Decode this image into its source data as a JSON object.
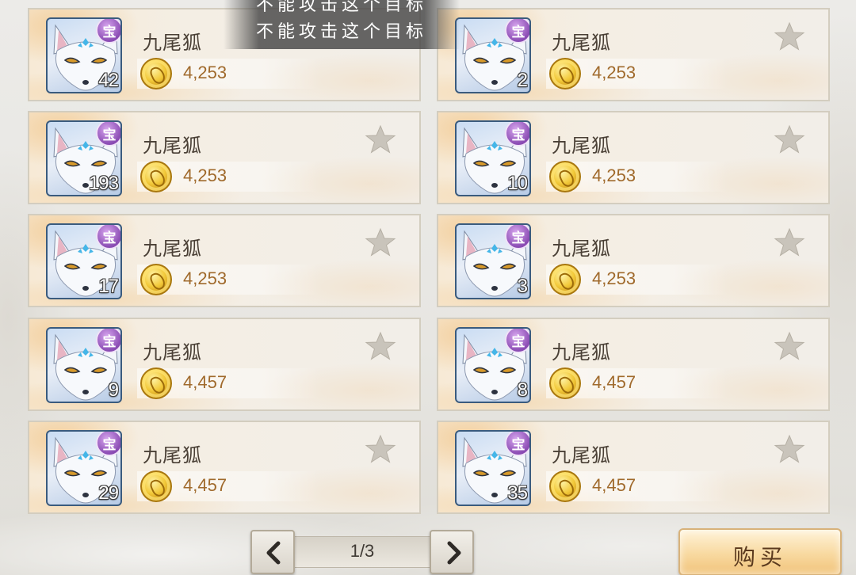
{
  "toast": {
    "ghost_text": "不能攻击这个目标",
    "text": "不能攻击这个目标"
  },
  "badge_char": "宝",
  "items": [
    {
      "name": "九尾狐",
      "price": "4,253",
      "count": "42"
    },
    {
      "name": "九尾狐",
      "price": "4,253",
      "count": "2"
    },
    {
      "name": "九尾狐",
      "price": "4,253",
      "count": "193"
    },
    {
      "name": "九尾狐",
      "price": "4,253",
      "count": "10"
    },
    {
      "name": "九尾狐",
      "price": "4,253",
      "count": "17"
    },
    {
      "name": "九尾狐",
      "price": "4,253",
      "count": "3"
    },
    {
      "name": "九尾狐",
      "price": "4,457",
      "count": "9"
    },
    {
      "name": "九尾狐",
      "price": "4,457",
      "count": "8"
    },
    {
      "name": "九尾狐",
      "price": "4,457",
      "count": "29"
    },
    {
      "name": "九尾狐",
      "price": "4,457",
      "count": "35"
    }
  ],
  "pager": {
    "text": "1/3"
  },
  "buy_button": {
    "label": "购买"
  },
  "colors": {
    "price": "#a06a2c",
    "badge": "#8a4bb3",
    "star": "#c9c4bb"
  },
  "icons": {
    "coin": "gold-coin-icon",
    "star": "star-icon",
    "prev": "chevron-left-icon",
    "next": "chevron-right-icon"
  }
}
